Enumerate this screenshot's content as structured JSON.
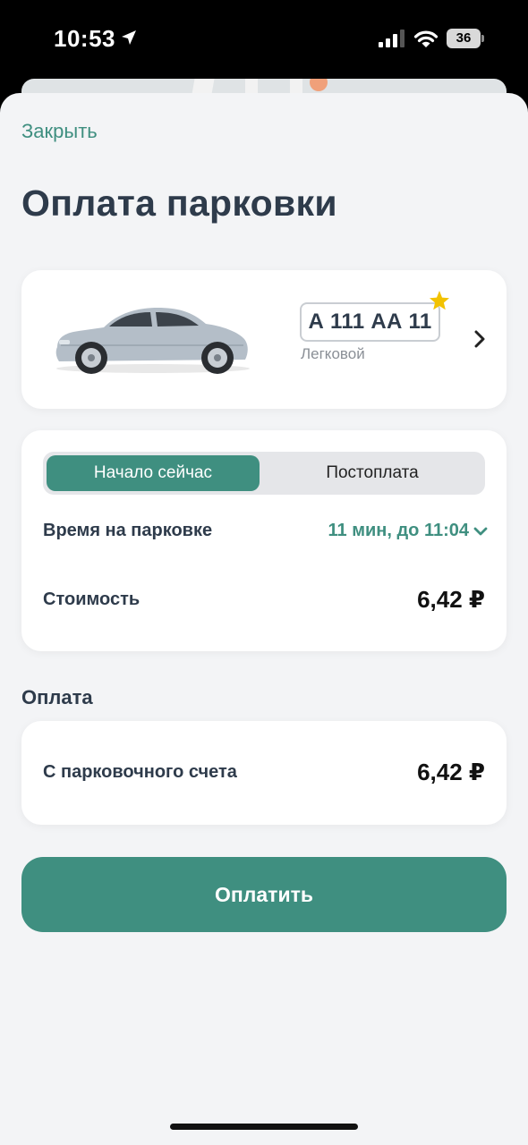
{
  "status_bar": {
    "time": "10:53",
    "battery": "36"
  },
  "sheet": {
    "close_label": "Закрыть",
    "title": "Оплата парковки"
  },
  "vehicle": {
    "plate": "А 111 АА 11",
    "type": "Легковой",
    "favorite": true
  },
  "params": {
    "tabs": [
      {
        "label": "Начало сейчас",
        "active": true
      },
      {
        "label": "Постоплата",
        "active": false
      }
    ],
    "duration_label": "Время на парковке",
    "duration_value": "11 мин, до 11:04",
    "cost_label": "Стоимость",
    "cost_value": "6,42 ₽"
  },
  "payment": {
    "section_title": "Оплата",
    "method_label": "С парковочного счета",
    "amount": "6,42 ₽"
  },
  "pay_button_label": "Оплатить",
  "colors": {
    "accent": "#3f8f80",
    "title": "#2e3b4b",
    "background": "#f3f4f6",
    "star": "#f2c200"
  }
}
